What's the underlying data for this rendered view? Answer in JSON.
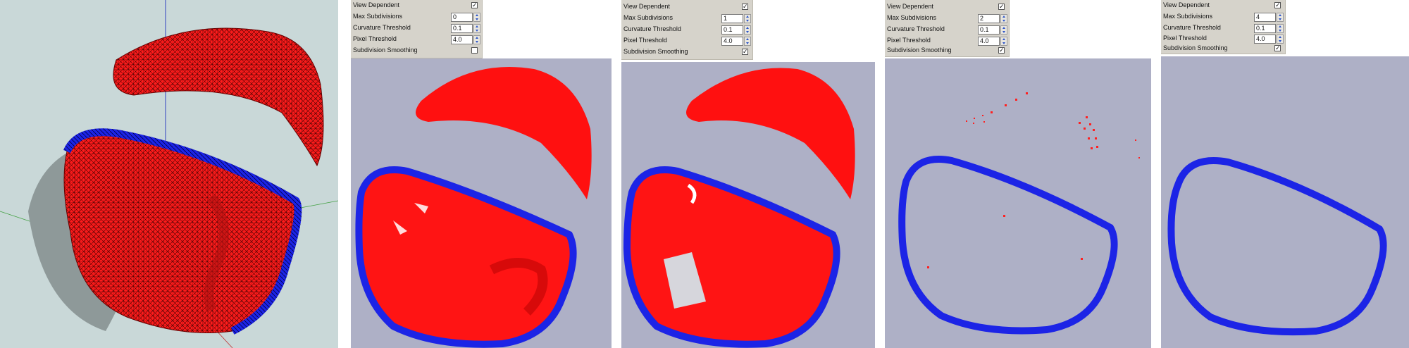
{
  "settings_labels": {
    "view_dependent": "View Dependent",
    "max_subdivisions": "Max Subdivisions",
    "curvature_threshold": "Curvature Threshold",
    "pixel_threshold": "Pixel Threshold",
    "subdivision_smoothing": "Subdivision Smoothing"
  },
  "panels": [
    {
      "view_dependent": "✓",
      "max_subdivisions": "0",
      "curvature_threshold": "0.1",
      "pixel_threshold": "4.0",
      "subdivision_smoothing": ""
    },
    {
      "view_dependent": "✓",
      "max_subdivisions": "1",
      "curvature_threshold": "0.1",
      "pixel_threshold": "4.0",
      "subdivision_smoothing": "✓"
    },
    {
      "view_dependent": "✓",
      "max_subdivisions": "2",
      "curvature_threshold": "0.1",
      "pixel_threshold": "4.0",
      "subdivision_smoothing": "✓"
    },
    {
      "view_dependent": "✓",
      "max_subdivisions": "4",
      "curvature_threshold": "0.1",
      "pixel_threshold": "4.0",
      "subdivision_smoothing": "✓"
    }
  ],
  "colors": {
    "viewport_bg": "#c9d8d8",
    "render_bg": "#aeb0c6",
    "mesh_red": "#ff1a1a",
    "rim_blue": "#1c24e6",
    "panel_bg": "#d6d3cb"
  }
}
